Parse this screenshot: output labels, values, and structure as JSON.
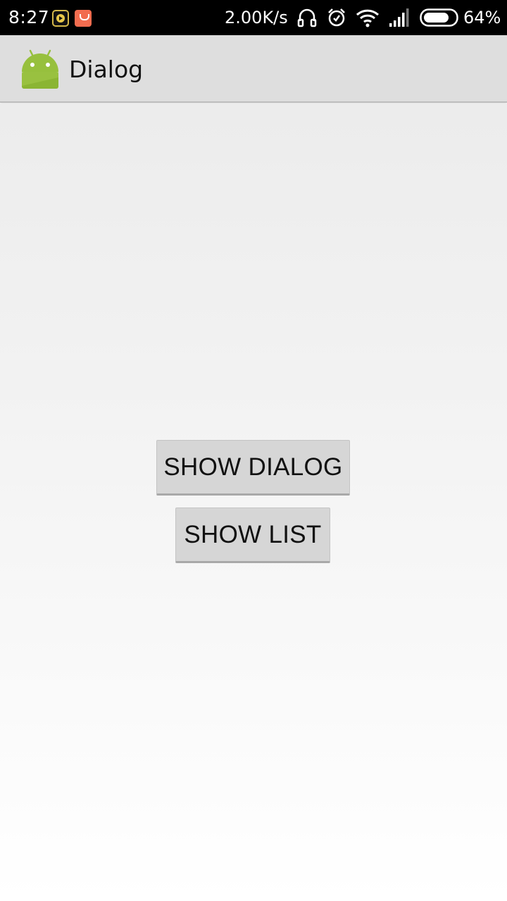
{
  "status_bar": {
    "time": "8:27",
    "network_speed": "2.00K/s",
    "battery_percent": "64%",
    "battery_level": 0.64,
    "icons": [
      "video-player-app-icon",
      "app-notification-icon",
      "headphones-icon",
      "alarm-icon",
      "wifi-icon",
      "signal-icon",
      "battery-icon"
    ]
  },
  "action_bar": {
    "title": "Dialog",
    "logo_icon": "android-robot-icon",
    "logo_color": "#97C03D"
  },
  "main": {
    "show_dialog_label": "SHOW DIALOG",
    "show_list_label": "SHOW LIST"
  }
}
